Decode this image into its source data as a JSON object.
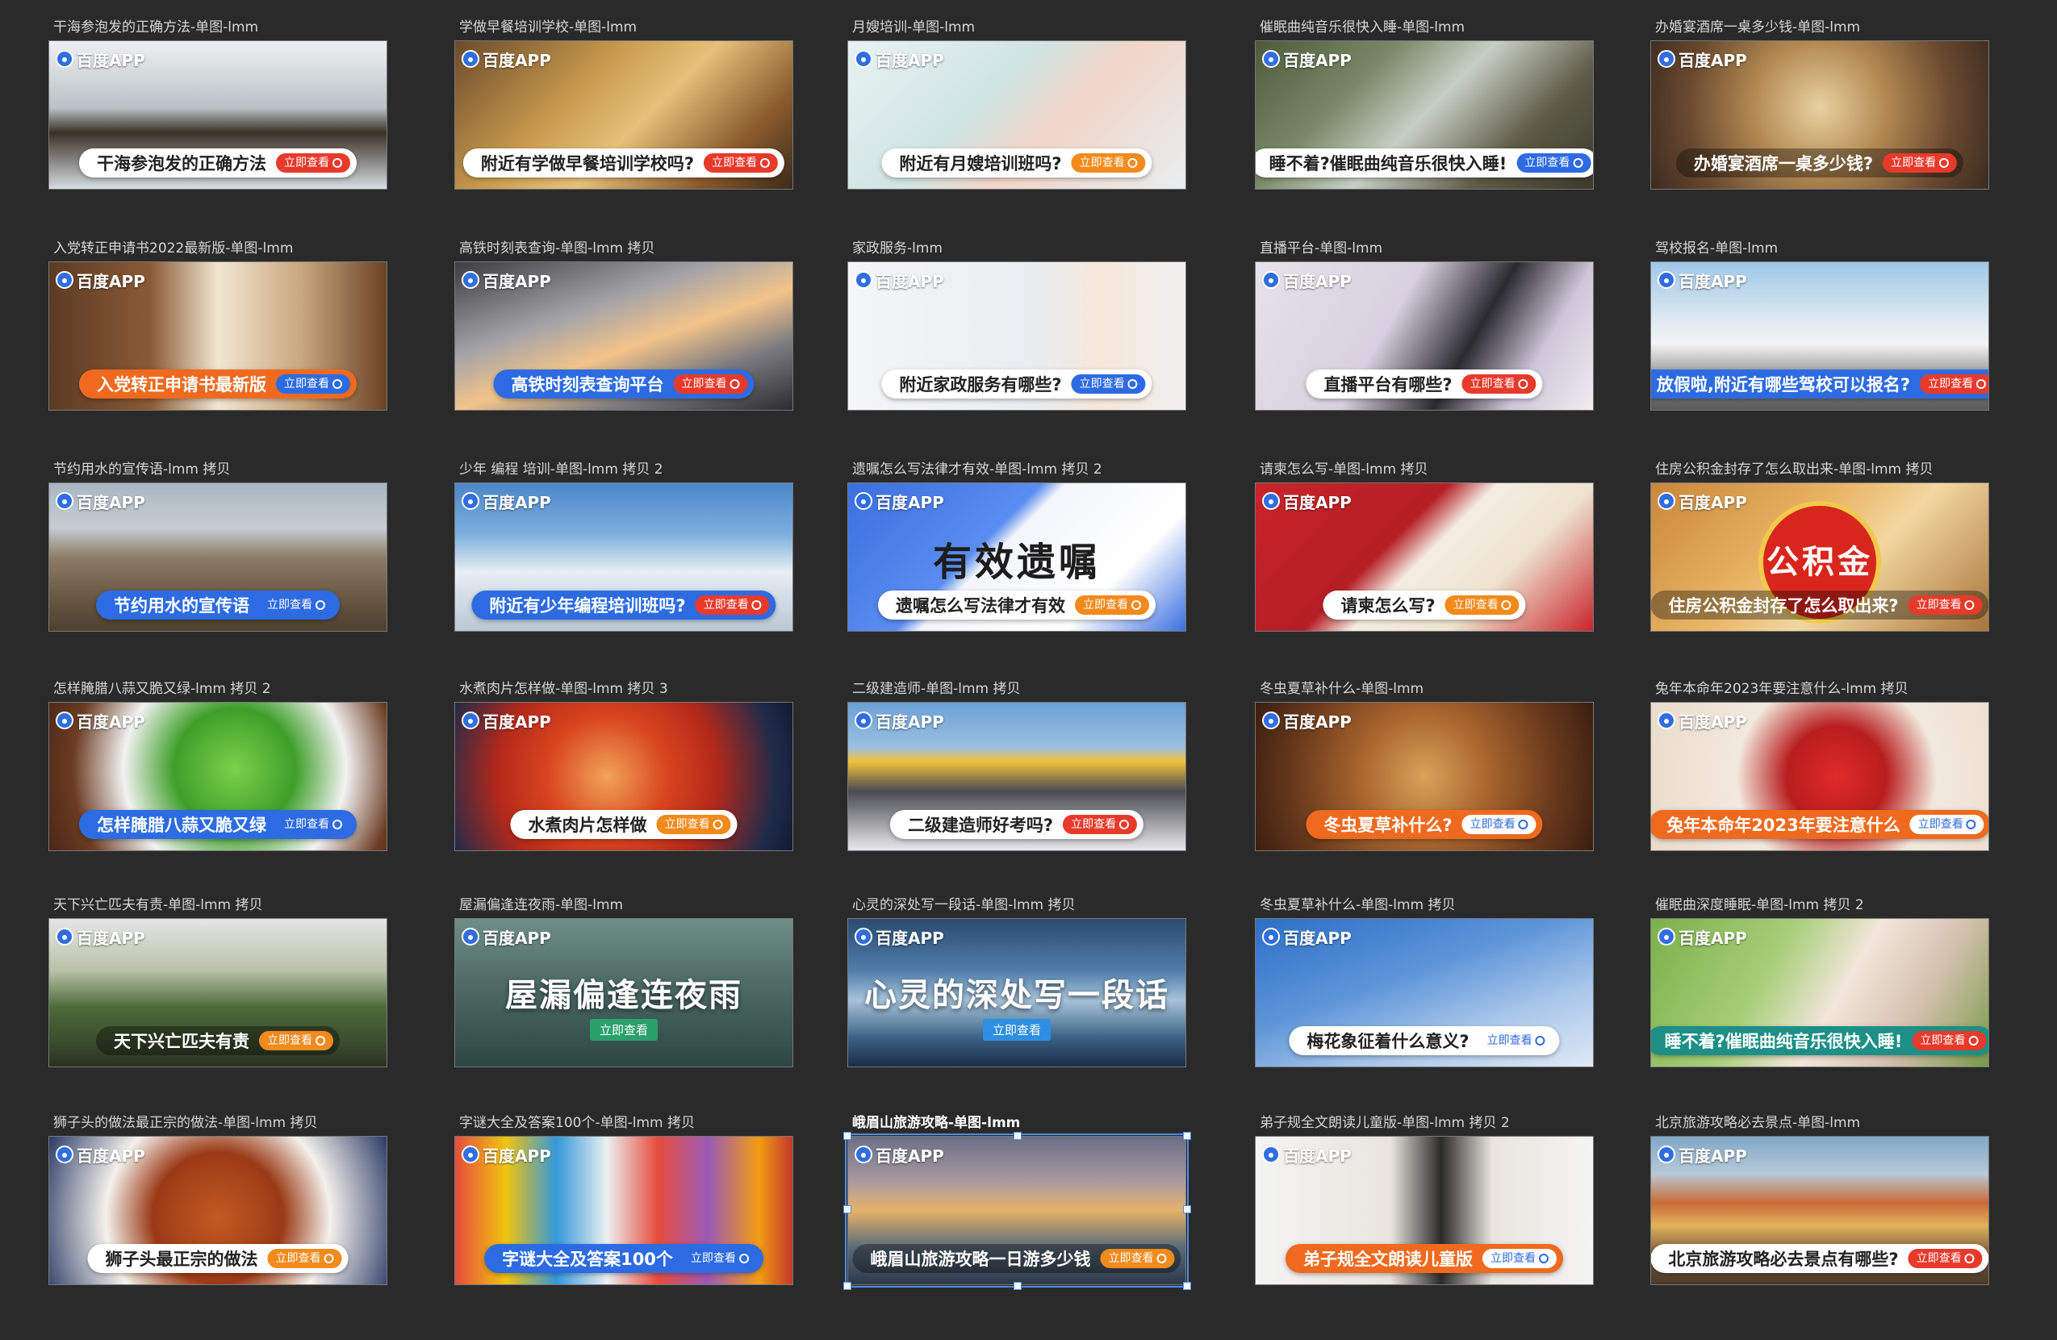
{
  "frames": [
    {
      "label": "干海参泡发的正确方法-单图-lmm",
      "logo": "百度APP",
      "text": "干海参泡发的正确方法",
      "cta": "立即查看",
      "style": "white",
      "cta_style": "red",
      "bg": "linear-gradient(180deg,#eef0f0 0%,#b9c3c7 45%,#3b3026 62%,#d4dde0 100%)"
    },
    {
      "label": "学做早餐培训学校-单图-lmm",
      "logo": "百度APP",
      "text": "附近有学做早餐培训学校吗?",
      "cta": "立即查看",
      "style": "white",
      "cta_style": "red",
      "bg": "linear-gradient(135deg,#6b4a2a 0%,#c89a4e 35%,#e6c07a 55%,#8a5a2c 80%,#3a2a1a 100%)"
    },
    {
      "label": "月嫂培训-单图-lmm",
      "logo": "百度APP",
      "text": "附近有月嫂培训班吗?",
      "cta": "立即查看",
      "style": "white",
      "cta_style": "orange",
      "bg": "linear-gradient(135deg,#e9f2f3 0%,#cfe4e3 40%,#f1d5c8 60%,#e7eef0 100%)"
    },
    {
      "label": "催眠曲纯音乐很快入睡-单图-lmm",
      "logo": "百度APP",
      "text": "睡不着?催眠曲纯音乐很快入睡!",
      "cta": "立即查看",
      "style": "white",
      "cta_style": "blue",
      "bg": "linear-gradient(135deg,#4c5a3b 0%,#7a8a68 30%,#c7cfc4 50%,#5d5a46 75%,#3a3a2c 100%)"
    },
    {
      "label": "办婚宴酒席一桌多少钱-单图-lmm",
      "logo": "百度APP",
      "text": "办婚宴酒席一桌多少钱?",
      "cta": "立即查看",
      "style": "none",
      "cta_style": "red",
      "bg": "radial-gradient(circle at 50% 45%,#e8d2a2 0%,#b48a52 35%,#6a4a30 70%,#3a2a20 100%)"
    },
    {
      "label": "入党转正申请书2022最新版-单图-lmm",
      "logo": "百度APP",
      "text": "入党转正申请书最新版",
      "cta": "立即查看",
      "style": "orange",
      "cta_style": "blue",
      "bg": "linear-gradient(90deg,#5b3a22 0%,#8a5a36 30%,#f2e6d2 50%,#c8a67e 75%,#6a4326 100%)"
    },
    {
      "label": "高铁时刻表查询-单图-lmm 拷贝",
      "logo": "百度APP",
      "text": "高铁时刻表查询平台",
      "cta": "立即查看",
      "style": "blue",
      "cta_style": "red",
      "bg": "linear-gradient(160deg,#3b3b40 0%,#a3a3a8 35%,#f3c48a 55%,#7a7a80 75%,#2b2b2f 100%)"
    },
    {
      "label": "家政服务-lmm",
      "logo": "百度APP",
      "text": "附近家政服务有哪些?",
      "cta": "立即查看",
      "style": "white",
      "cta_style": "blue",
      "bg": "linear-gradient(90deg,#f4f6f8 0%,#e9edf1 55%,#f6e7da 75%,#f0f0f0 100%)"
    },
    {
      "label": "直播平台-单图-lmm",
      "logo": "百度APP",
      "text": "直播平台有哪些?",
      "cta": "立即查看",
      "style": "white",
      "cta_style": "red",
      "bg": "linear-gradient(120deg,#e6e2ea 0%,#d8d0e0 40%,#2a2a30 62%,#cfc6d8 80%,#f0ecf2 100%)"
    },
    {
      "label": "驾校报名-单图-lmm",
      "logo": "百度APP",
      "text": "放假啦,附近有哪些驾校可以报名?",
      "cta": "立即查看",
      "style": "blue",
      "cta_style": "red",
      "bg": "linear-gradient(180deg,#9ec7e8 0%,#d7e6ef 35%,#f4f4f4 55%,#8a8a8a 80%,#5a5a5a 100%)"
    },
    {
      "label": "节约用水的宣传语-lmm 拷贝",
      "logo": "百度APP",
      "text": "节约用水的宣传语",
      "cta": "立即查看",
      "style": "blue",
      "cta_style": "blue",
      "bg": "linear-gradient(180deg,#a9b6c1 0%,#c6cdd2 30%,#8d7d66 50%,#6b5a45 75%,#4e4030 100%)"
    },
    {
      "label": "少年 编程 培训-单图-lmm 拷贝 2",
      "logo": "百度APP",
      "text": "附近有少年编程培训班吗?",
      "cta": "立即查看",
      "style": "blue",
      "cta_style": "red",
      "bg": "linear-gradient(180deg,#4a86c9 0%,#7fb0de 35%,#e7eef4 60%,#b9c8d6 100%)"
    },
    {
      "label": "遗嘱怎么写法律才有效-单图-lmm 拷贝 2",
      "logo": "百度APP",
      "text": "遗嘱怎么写法律才有效",
      "cta": "立即查看",
      "style": "white",
      "cta_style": "orange",
      "bg": "linear-gradient(135deg,#3a6fe0 0%,#5a8df0 40%,#f3f5fb 45%,#ffffff 75%,#3a6fe0 100%)",
      "stamp": "有效遗嘱"
    },
    {
      "label": "请柬怎么写-单图-lmm 拷贝",
      "logo": "百度APP",
      "text": "请柬怎么写?",
      "cta": "立即查看",
      "style": "white",
      "cta_style": "orange",
      "bg": "linear-gradient(135deg,#c8242a 0%,#b51e25 40%,#f4ede2 50%,#efe3cf 70%,#c8242a 100%)"
    },
    {
      "label": "住房公积金封存了怎么取出来-单图-lmm 拷贝",
      "logo": "百度APP",
      "text": "住房公积金封存了怎么取出来?",
      "cta": "立即查看",
      "style": "none",
      "cta_style": "red",
      "bg": "linear-gradient(135deg,#c9873b 0%,#e9b465 40%,#f3d7a0 60%,#a8743a 100%)",
      "stamp": "公积金"
    },
    {
      "label": "怎样腌腊八蒜又脆又绿-lmm 拷贝 2",
      "logo": "百度APP",
      "text": "怎样腌腊八蒜又脆又绿",
      "cta": "立即查看",
      "style": "blue",
      "cta_style": "blue",
      "bg": "radial-gradient(circle at 55% 45%,#7bd14a 0%,#3f9f2a 30%,#f2f2f2 55%,#6b3c22 80%,#4a2616 100%)"
    },
    {
      "label": "水煮肉片怎样做-单图-lmm 拷贝 3",
      "logo": "百度APP",
      "text": "水煮肉片怎样做",
      "cta": "立即查看",
      "style": "white",
      "cta_style": "orange",
      "bg": "radial-gradient(circle at 45% 50%,#f2a35a 0%,#d8451e 30%,#b3281a 55%,#1e2b4a 85%,#101a30 100%)"
    },
    {
      "label": "二级建造师-单图-lmm 拷贝",
      "logo": "百度APP",
      "text": "二级建造师好考吗?",
      "cta": "立即查看",
      "style": "white",
      "cta_style": "red",
      "bg": "linear-gradient(180deg,#6aa0d4 0%,#9bc0e2 30%,#f2c13a 40%,#4a4a52 60%,#e8e8ec 100%)"
    },
    {
      "label": "冬虫夏草补什么-单图-lmm",
      "logo": "百度APP",
      "text": "冬虫夏草补什么?",
      "cta": "立即查看",
      "style": "orange",
      "cta_style": "white",
      "bg": "radial-gradient(circle at 50% 50%,#d9a35a 0%,#a8652e 35%,#6a3a1c 70%,#3a1e10 100%)"
    },
    {
      "label": "兔年本命年2023年要注意什么-lmm 拷贝",
      "logo": "百度APP",
      "text": "兔年本命年2023年要注意什么",
      "cta": "立即查看",
      "style": "orange",
      "cta_style": "white",
      "bg": "radial-gradient(circle at 55% 50%,#e02a2a 0%,#b81d1d 25%,#f2e8dc 50%,#e9dccb 100%)"
    },
    {
      "label": "天下兴亡匹夫有责-单图-lmm 拷贝",
      "logo": "百度APP",
      "text": "天下兴亡匹夫有责",
      "cta": "立即查看",
      "style": "none",
      "cta_style": "orange",
      "bg": "linear-gradient(180deg,#e4e6e3 0%,#b9c2a8 35%,#4c6a3a 60%,#3a4a2c 85%,#2a3020 100%)"
    },
    {
      "label": "屋漏偏逢连夜雨-单图-lmm",
      "logo": "百度APP",
      "text": "屋漏偏逢连夜雨",
      "cta": "立即查看",
      "style": "center",
      "cta_style": "green",
      "bg": "linear-gradient(180deg,#6f8f86 0%,#506e67 40%,#3e5a55 70%,#2e4642 100%)"
    },
    {
      "label": "心灵的深处写一段话-单图-lmm 拷贝",
      "logo": "百度APP",
      "text": "心灵的深处写一段话",
      "cta": "立即查看",
      "style": "center",
      "cta_style": "blue",
      "bg": "linear-gradient(180deg,#2a4a6e 0%,#4f7eaa 35%,#a9c4da 55%,#3c6488 80%,#1a2e46 100%)"
    },
    {
      "label": "冬虫夏草补什么-单图-lmm 拷贝",
      "logo": "百度APP",
      "text": "梅花象征着什么意义?",
      "cta": "立即查看",
      "style": "white",
      "cta_style": "white",
      "bg": "linear-gradient(160deg,#2d6fc7 0%,#5b94d8 40%,#a9c7ea 70%,#dfe9f5 100%)"
    },
    {
      "label": "催眠曲深度睡眠-单图-lmm 拷贝 2",
      "logo": "百度APP",
      "text": "睡不着?催眠曲纯音乐很快入睡!",
      "cta": "立即查看",
      "style": "teal",
      "cta_style": "red",
      "bg": "linear-gradient(120deg,#7bb04a 0%,#a8cf7a 35%,#f2e6da 55%,#d5c2b0 75%,#7a9a4a 100%)"
    },
    {
      "label": "狮子头的做法最正宗的做法-单图-lmm 拷贝",
      "logo": "百度APP",
      "text": "狮子头最正宗的做法",
      "cta": "立即查看",
      "style": "white",
      "cta_style": "orange",
      "bg": "radial-gradient(circle at 50% 55%,#c25a22 0%,#9a3a16 35%,#f4f1ec 60%,#2b3b66 100%)"
    },
    {
      "label": "字谜大全及答案100个-单图-lmm 拷贝",
      "logo": "百度APP",
      "text": "字谜大全及答案100个",
      "cta": "立即查看",
      "style": "blue",
      "cta_style": "blue",
      "bg": "linear-gradient(90deg,#e74c3c 0%,#f1c40f 15%,#3498db 30%,#ecf0f1 45%,#e74c3c 60%,#9b59b6 75%,#f39c12 90%,#c0392b 100%)"
    },
    {
      "label": "峨眉山旅游攻略-单图-lmm",
      "logo": "百度APP",
      "text": "峨眉山旅游攻略一日游多少钱",
      "cta": "立即查看",
      "style": "none",
      "cta_style": "orange",
      "bg": "linear-gradient(180deg,#6a6f86 0%,#a89aa0 30%,#e6b36a 50%,#5a6a7a 75%,#2c3a4a 100%)",
      "selected": true
    },
    {
      "label": "弟子规全文朗读儿童版-单图-lmm 拷贝 2",
      "logo": "百度APP",
      "text": "弟子规全文朗读儿童版",
      "cta": "立即查看",
      "style": "orange",
      "cta_style": "white",
      "bg": "linear-gradient(90deg,#f4f4f4 0%,#e9e4dd 40%,#2a2a2a 55%,#e9e4dd 70%,#f4f4f4 100%)"
    },
    {
      "label": "北京旅游攻略必去景点-单图-lmm",
      "logo": "百度APP",
      "text": "北京旅游攻略必去景点有哪些?",
      "cta": "立即查看",
      "style": "white",
      "cta_style": "red",
      "bg": "linear-gradient(180deg,#7fa8c8 0%,#b8c9d6 25%,#c96a36 45%,#e1b25a 60%,#7a5a3a 80%,#4a3a2a 100%)"
    }
  ]
}
